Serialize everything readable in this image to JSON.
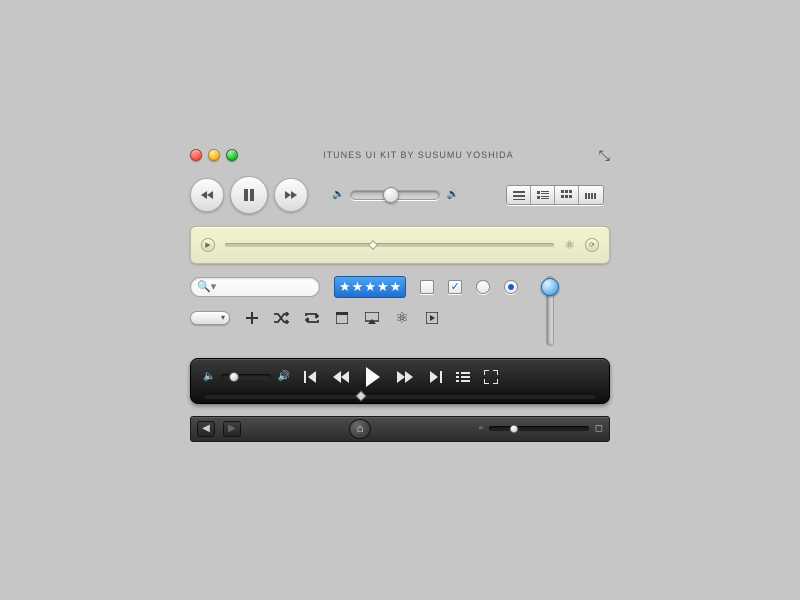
{
  "header": {
    "title": "ITUNES UI KIT BY SUSUMU YOSHIDA"
  },
  "traffic_lights": [
    "close",
    "minimize",
    "zoom"
  ],
  "playback": {
    "prev_icon": "rewind",
    "play_icon": "pause",
    "next_icon": "fast-forward"
  },
  "volume": {
    "low_icon": "volume-low",
    "high_icon": "volume-high",
    "value_pct": 45
  },
  "view_modes": [
    "list",
    "album-list",
    "grid",
    "coverflow"
  ],
  "lcd": {
    "play_icon": "play",
    "progress_pct": 45,
    "visualizer_icon": "atom",
    "repeat_icon": "repeat"
  },
  "search": {
    "placeholder": "",
    "value": ""
  },
  "rating": {
    "stars": 5,
    "max": 5
  },
  "checkbox_unchecked": false,
  "checkbox_checked": true,
  "radio_unselected": false,
  "radio_selected": true,
  "vslider_value_pct": 15,
  "pill_label": "▾",
  "small_icons": [
    "plus",
    "shuffle",
    "repeat",
    "window",
    "airplay",
    "atom",
    "play-boxed"
  ],
  "black_player": {
    "volume_pct": 25,
    "controls": [
      "prev-track",
      "rewind",
      "play",
      "fast-forward",
      "next-track",
      "playlist",
      "fullscreen"
    ],
    "progress_pct": 40
  },
  "navbar": {
    "back_enabled": true,
    "forward_enabled": false,
    "home_icon": "home",
    "zoom_small_icon": "thumb-small",
    "zoom_large_icon": "thumb-large",
    "zoom_value_pct": 25
  }
}
